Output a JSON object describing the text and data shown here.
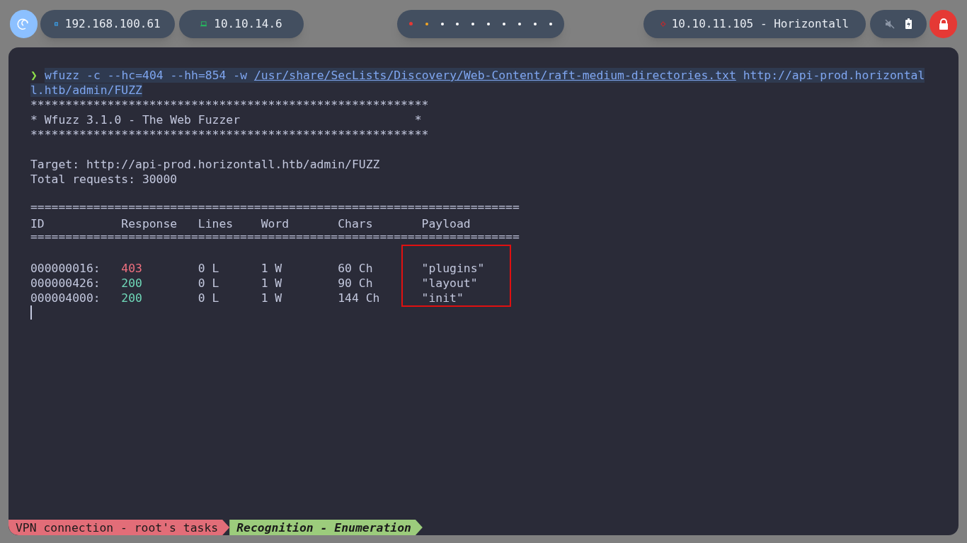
{
  "topbar": {
    "ethernet_ip": "192.168.100.61",
    "vpn_ip": "10.10.14.6",
    "workspaces": [
      {
        "color": "#e53935",
        "selected": true
      },
      {
        "color": "#f5a623",
        "selected": false
      },
      {
        "color": "#ffffff",
        "selected": false
      },
      {
        "color": "#ffffff",
        "selected": false
      },
      {
        "color": "#ffffff",
        "selected": false
      },
      {
        "color": "#ffffff",
        "selected": false
      },
      {
        "color": "#ffffff",
        "selected": false
      },
      {
        "color": "#ffffff",
        "selected": false
      },
      {
        "color": "#ffffff",
        "selected": false
      },
      {
        "color": "#ffffff",
        "selected": false
      }
    ],
    "target": "10.10.11.105 - Horizontall",
    "muted": true
  },
  "terminal": {
    "prompt": "❯",
    "command": "wfuzz -c --hc=404 --hh=854 -w",
    "wordlist": "/usr/share/SecLists/Discovery/Web-Content/raft-medium-directories.txt",
    "url_lines": [
      "http://api-prod.horizontal",
      "l.htb/admin/FUZZ"
    ],
    "banner": [
      "*********************************************************",
      "* Wfuzz 3.1.0 - The Web Fuzzer                         *",
      "*********************************************************"
    ],
    "info": [
      "Target: http://api-prod.horizontall.htb/admin/FUZZ",
      "Total requests: 30000"
    ],
    "separator": "======================================================================",
    "columns": [
      "ID",
      "Response",
      "Lines",
      "Word",
      "Chars",
      "Payload"
    ],
    "payload_highlighted": true,
    "rows": [
      {
        "id": "000000016:",
        "response": "403",
        "color": "#f0707f",
        "lines": "0 L",
        "word": "1 W",
        "chars": "60 Ch",
        "payload": "\"plugins\""
      },
      {
        "id": "000000426:",
        "response": "200",
        "color": "#6fd8b8",
        "lines": "0 L",
        "word": "1 W",
        "chars": "90 Ch",
        "payload": "\"layout\""
      },
      {
        "id": "000004000:",
        "response": "200",
        "color": "#6fd8b8",
        "lines": "0 L",
        "word": "1 W",
        "chars": "144 Ch",
        "payload": "\"init\""
      }
    ]
  },
  "statusbar": {
    "segments": [
      "VPN connection - root's tasks",
      "Recognition - Enumeration"
    ]
  }
}
